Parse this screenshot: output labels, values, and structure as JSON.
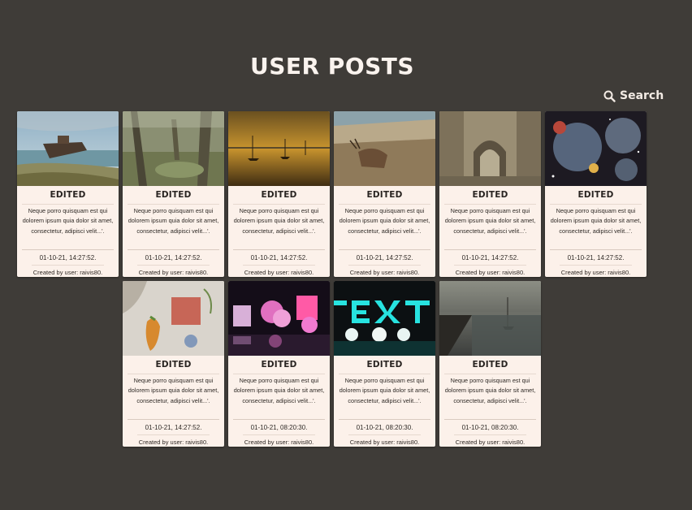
{
  "header": {
    "title": "USER POSTS",
    "search_label": "Search"
  },
  "posts": [
    {
      "title": "EDITED",
      "body": "Neque porro quisquam est qui dolorem ipsum quia dolor sit amet, consectetur, adipisci velit...'.",
      "date": "01-10-21, 14:27:52.",
      "author": "Created by user: raivis80.",
      "image": "shipwreck-beach"
    },
    {
      "title": "EDITED",
      "body": "Neque porro quisquam est qui dolorem ipsum quia dolor sit amet, consectetur, adipisci velit...'.",
      "date": "01-10-21, 14:27:52.",
      "author": "Created by user: raivis80.",
      "image": "forest-trees"
    },
    {
      "title": "EDITED",
      "body": "Neque porro quisquam est qui dolorem ipsum quia dolor sit amet, consectetur, adipisci velit...'.",
      "date": "01-10-21, 14:27:52.",
      "author": "Created by user: raivis80.",
      "image": "sunset-harbor"
    },
    {
      "title": "EDITED",
      "body": "Neque porro quisquam est qui dolorem ipsum quia dolor sit amet, consectetur, adipisci velit...'.",
      "date": "01-10-21, 14:27:52.",
      "author": "Created by user: raivis80.",
      "image": "deer-field"
    },
    {
      "title": "EDITED",
      "body": "Neque porro quisquam est qui dolorem ipsum quia dolor sit amet, consectetur, adipisci velit...'.",
      "date": "01-10-21, 14:27:52.",
      "author": "Created by user: raivis80.",
      "image": "ruined-abbey"
    },
    {
      "title": "EDITED",
      "body": "Neque porro quisquam est qui dolorem ipsum quia dolor sit amet, consectetur, adipisci velit...'.",
      "date": "01-10-21, 14:27:52.",
      "author": "Created by user: raivis80.",
      "image": "fantasy-bubbles"
    },
    {
      "title": "EDITED",
      "body": "Neque porro quisquam est qui dolorem ipsum quia dolor sit amet, consectetur, adipisci velit...'.",
      "date": "01-10-21, 14:27:52.",
      "author": "Created by user: raivis80.",
      "image": "painted-wall"
    },
    {
      "title": "EDITED",
      "body": "Neque porro quisquam est qui dolorem ipsum quia dolor sit amet, consectetur, adipisci velit...'.",
      "date": "01-10-21, 08:20:30.",
      "author": "Created by user: raivis80.",
      "image": "neon-hearts"
    },
    {
      "title": "EDITED",
      "body": "Neque porro quisquam est qui dolorem ipsum quia dolor sit amet, consectetur, adipisci velit...'.",
      "date": "01-10-21, 08:20:30.",
      "author": "Created by user: raivis80.",
      "image": "neon-text"
    },
    {
      "title": "EDITED",
      "body": "Neque porro quisquam est qui dolorem ipsum quia dolor sit amet, consectetur, adipisci velit...'.",
      "date": "01-10-21, 08:20:30.",
      "author": "Created by user: raivis80.",
      "image": "calm-harbor"
    }
  ],
  "colors": {
    "background": "#3f3c38",
    "card": "#fcf1ea",
    "title": "#faf3ee"
  }
}
